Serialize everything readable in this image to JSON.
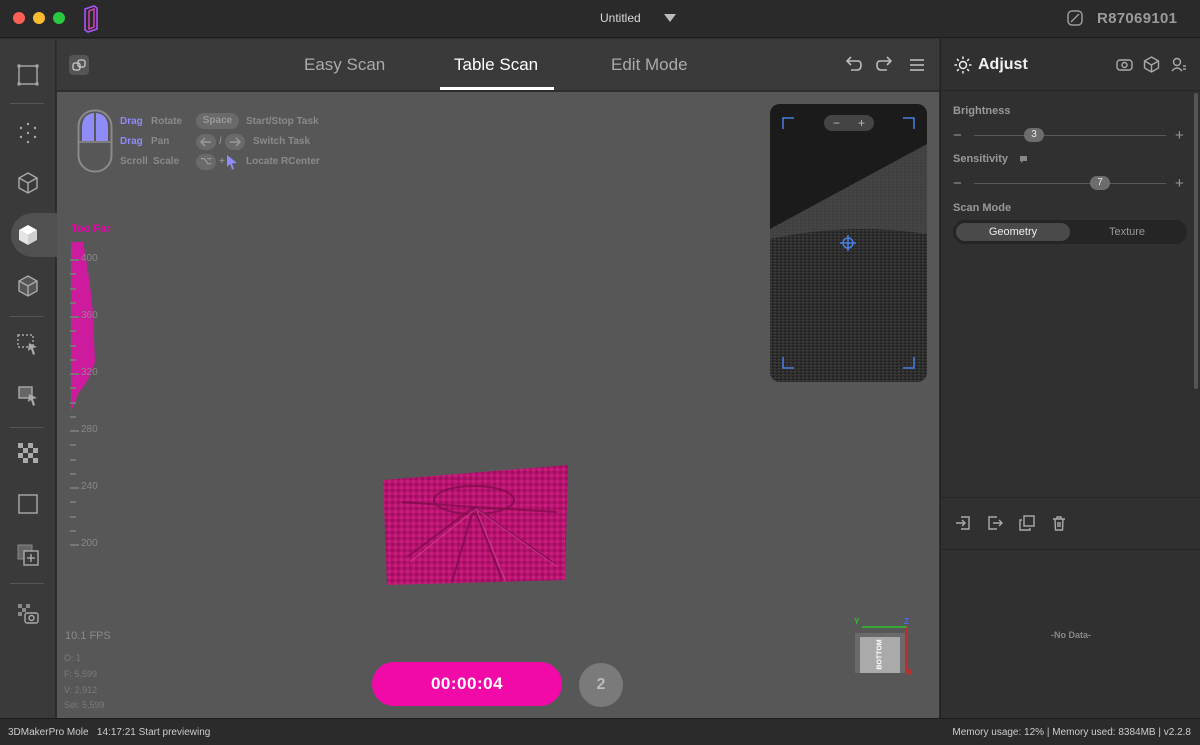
{
  "window": {
    "title": "Untitled",
    "device_id": "R87069101"
  },
  "modes": {
    "tabs": [
      {
        "label": "Easy Scan",
        "active": false
      },
      {
        "label": "Table Scan",
        "active": true
      },
      {
        "label": "Edit Mode",
        "active": false
      }
    ]
  },
  "hints": {
    "drag_rotate_key": "Drag",
    "drag_rotate_action": "Rotate",
    "drag_pan_key": "Drag",
    "drag_pan_action": "Pan",
    "scroll_key": "Scroll",
    "scroll_action": "Scale",
    "space_chip": "Space",
    "space_action": "Start/Stop Task",
    "arrows_sep": "/",
    "arrows_action": "Switch Task",
    "option_chip": "⌥",
    "option_plus": "+",
    "option_action": "Locate RCenter"
  },
  "distance": {
    "status": "Too Far",
    "ticks": [
      "400",
      "360",
      "320",
      "280",
      "240",
      "200"
    ]
  },
  "preview": {
    "zoom_minus": "−",
    "zoom_plus": "+"
  },
  "stats": {
    "fps": "10.1 FPS",
    "o": "O: 1",
    "f": "F: 5,599",
    "v": "V: 2,912",
    "sel": "Sel: 5,599"
  },
  "scan": {
    "timer": "00:00:04",
    "count": "2"
  },
  "gizmo": {
    "face": "BOTTOM",
    "axis_y": "Y",
    "axis_z": "Z",
    "axis_x": "X"
  },
  "adjust": {
    "title": "Adjust",
    "brightness_label": "Brightness",
    "brightness_value": "3",
    "sensitivity_label": "Sensitivity",
    "sensitivity_value": "7",
    "scan_mode_label": "Scan Mode",
    "scan_mode_options": [
      "Geometry",
      "Texture"
    ],
    "scan_mode_selected": "Geometry",
    "minus": "−",
    "plus": "+",
    "no_data": "-No Data-"
  },
  "status": {
    "left": "3DMakerPro Mole   14:17:21 Start previewing",
    "right": "Memory usage: 12% | Memory used: 8384MB | v2.2.8"
  },
  "colors": {
    "accent_magenta": "#f20aa8",
    "hint_purple": "#8f8cf8",
    "too_far_text": "#ee00aa"
  }
}
